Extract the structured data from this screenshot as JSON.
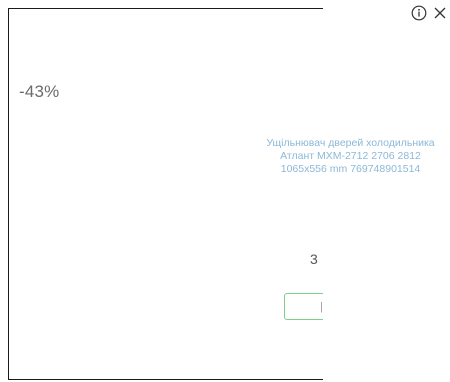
{
  "ad": {
    "discount_label": "-43%",
    "product_title_lines": [
      "Ущільнювач дверей холодильника",
      "Атлант МХМ-2712 2706 2812",
      "1065x556 mm 769748901514"
    ],
    "price_fragment": "3",
    "cta_fragment": "|"
  },
  "controls": {
    "info_icon": "info-circle-icon",
    "close_icon": "close-x-icon"
  },
  "colors": {
    "title_text": "#8cb8d8",
    "cta_border": "#7dcf8a",
    "frame_border": "#1a1a1a"
  }
}
